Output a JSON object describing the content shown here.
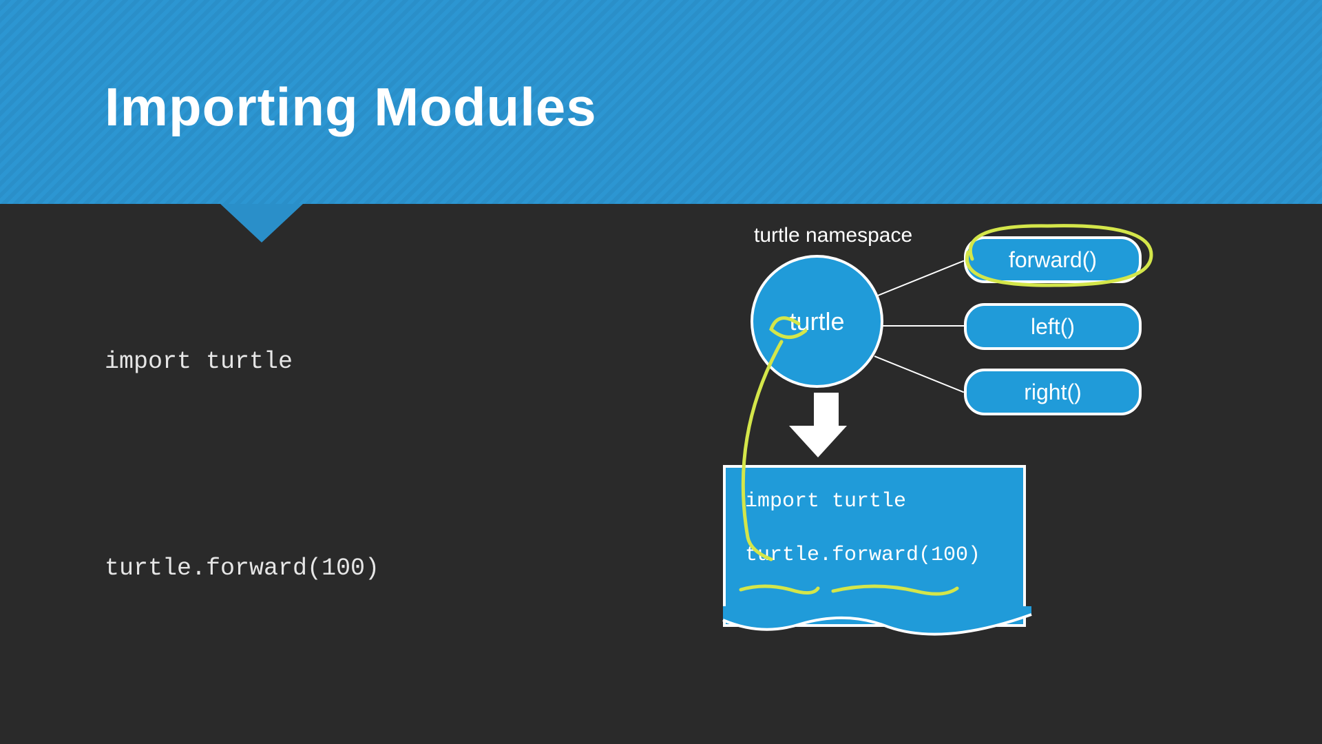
{
  "title": "Importing Modules",
  "code": {
    "line1": "import turtle",
    "line2": "turtle.forward(100)"
  },
  "diagram": {
    "namespace_label": "turtle namespace",
    "module_name": "turtle",
    "methods": [
      "forward()",
      "left()",
      "right()"
    ],
    "example": {
      "line1": "import turtle",
      "line2": "turtle.forward(100)"
    }
  },
  "colors": {
    "accent": "#209bd9",
    "ink": "#d4e64a",
    "bg": "#2a2a2a"
  }
}
